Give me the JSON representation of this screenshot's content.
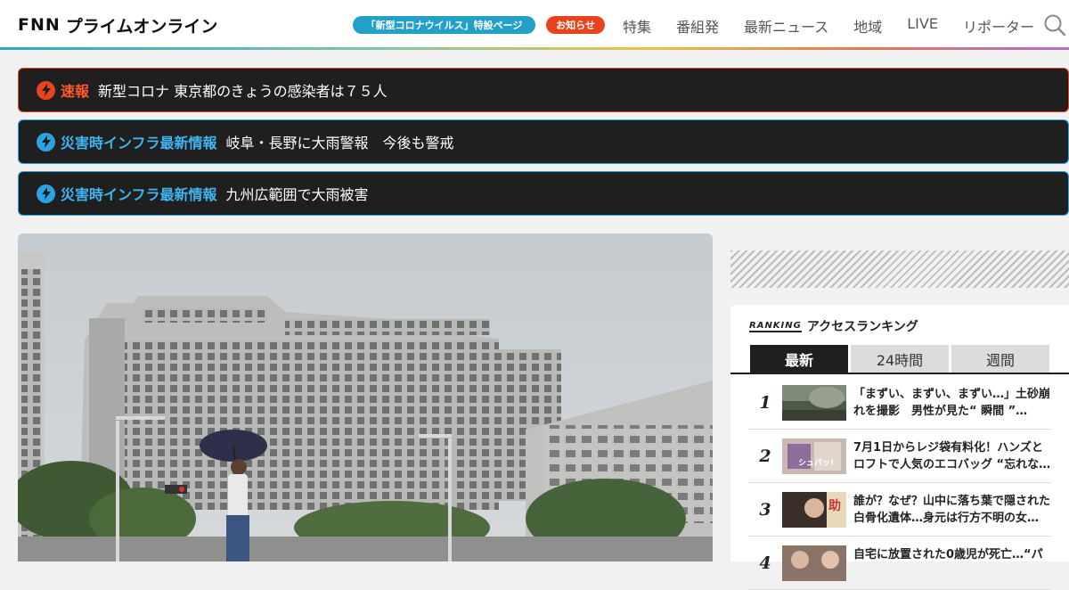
{
  "header": {
    "logo_prefix": "FNN",
    "logo_text": "プライムオンライン",
    "corona_pill": "「新型コロナウイルス」特設ページ",
    "notice_pill": "お知らせ",
    "nav": [
      "特集",
      "番組発",
      "最新ニュース",
      "地域",
      "LIVE",
      "リポーター"
    ]
  },
  "alerts": [
    {
      "tag": "速報",
      "text": "新型コロナ 東京都のきょうの感染者は７５人",
      "color": "#e8431f"
    },
    {
      "tag": "災害時インフラ最新情報",
      "text": "岐阜・長野に大雨警報　今後も警戒",
      "color": "#2ba3e0"
    },
    {
      "tag": "災害時インフラ最新情報",
      "text": "九州広範囲で大雨被害",
      "color": "#2ba3e0"
    }
  ],
  "ranking": {
    "badge": "RANKING",
    "title": "アクセスランキング",
    "tabs": [
      "最新",
      "24時間",
      "週間"
    ],
    "items": [
      {
        "num": "1",
        "title": "「まずい、まずい、まずい…」土砂崩れを撮影　男性が見た“ 瞬間 ”…"
      },
      {
        "num": "2",
        "title": "7月1日からレジ袋有料化！ハンズとロフトで人気のエコバッグ “忘れな…"
      },
      {
        "num": "3",
        "title": "誰が？なぜ？山中に落ち葉で隠された白骨化遺体…身元は行方不明の女…"
      },
      {
        "num": "4",
        "title": "自宅に放置された0歳児が死亡…“パ"
      }
    ],
    "thumb_text_2": "シュパッ!",
    "thumb_text_3": "助"
  }
}
